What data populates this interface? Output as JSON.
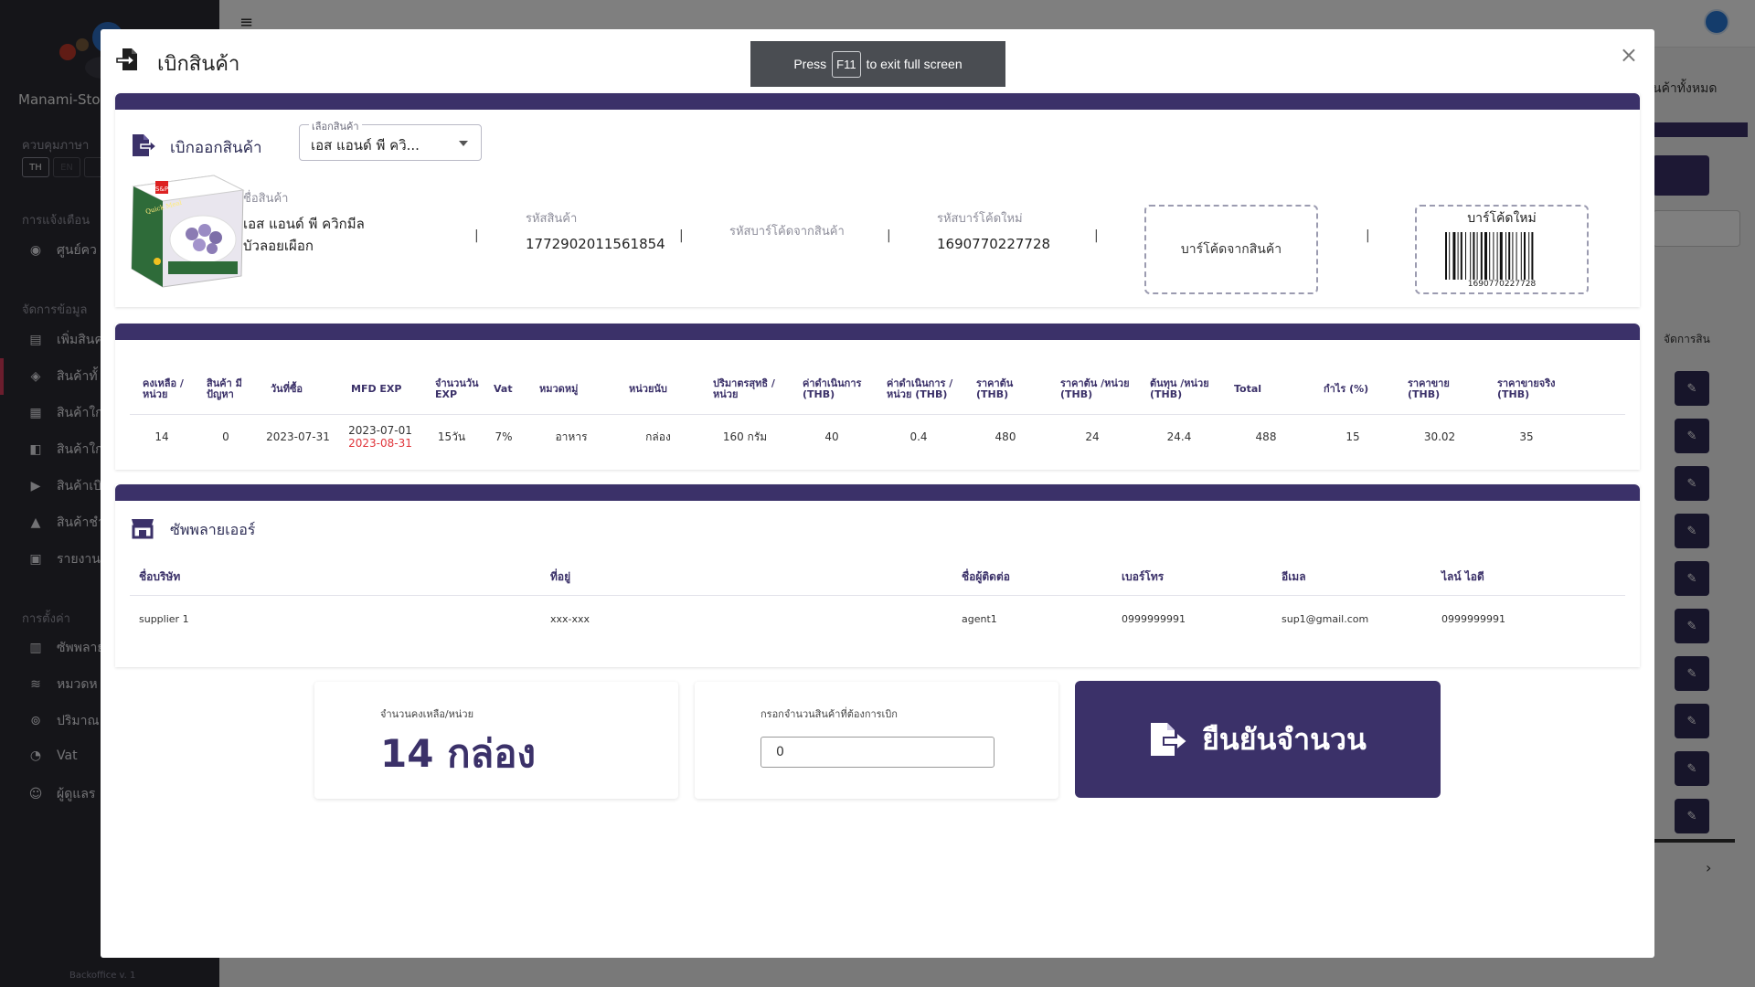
{
  "sidebar": {
    "brand": "Manami-Stoc",
    "sections": {
      "language": "ควบคุมภาษา",
      "notifications": "การแจ้งเตือน",
      "data_management": "จัดการข้อมูล",
      "settings": "การตั้งค่า"
    },
    "languages": [
      "TH",
      "EN",
      ""
    ],
    "items": [
      {
        "label": "ศูนย์คว",
        "icon": "gamepad-icon"
      },
      {
        "label": "เพิ่มสินค",
        "icon": "file-import-icon"
      },
      {
        "label": "สินค้าทั้",
        "icon": "boxes-icon"
      },
      {
        "label": "สินค้าใก",
        "icon": "calendar-icon"
      },
      {
        "label": "สินค้าใก",
        "icon": "layers-icon"
      },
      {
        "label": "สินค้าเบิ",
        "icon": "file-export-icon"
      },
      {
        "label": "สินค้าชำ",
        "icon": "warning-icon"
      },
      {
        "label": "รายงาน",
        "icon": "report-icon"
      },
      {
        "label": "ซัพพลาย",
        "icon": "store-icon"
      },
      {
        "label": "หมวดห",
        "icon": "stack-icon"
      },
      {
        "label": "ปริมาณ",
        "icon": "scale-icon"
      },
      {
        "label": "Vat",
        "icon": "pie-icon"
      },
      {
        "label": "ผู้ดูแลร",
        "icon": "user-gear-icon"
      }
    ],
    "version": "Backoffice v. 1"
  },
  "background": {
    "right_text": "นค้าทั้งหมด",
    "column_label": "จัดการสิน"
  },
  "fullscreen_toast": {
    "press": "Press",
    "key": "F11",
    "rest": "to exit full screen"
  },
  "modal": {
    "title": "เบิกสินค้า",
    "close": "×",
    "product_section": {
      "title": "เบิกออกสินค้า",
      "select_legend": "เลือกสินค้า",
      "select_value": "เอส แอนด์ พี ควิ..."
    },
    "product": {
      "name_label": "ชื่อสินค้า",
      "name_value": "เอส แอนด์ พี ควิกมีล บัวลอยเผือก",
      "code_label": "รหัสสินค้า",
      "code_value": "1772902011561854",
      "barcode_label": "รหัสบาร์โค้ดจากสินค้า",
      "barcode_value": "",
      "new_barcode_label": "รหัสบาร์โค้ดใหม่",
      "new_barcode_value": "1690770227728",
      "barcode_from_product_box": "บาร์โค้ดจากสินค้า",
      "new_barcode_box_title": "บาร์โค้ดใหม่",
      "new_barcode_box_number": "1690770227728",
      "separator": "|",
      "image_brand_text": "Quick Meal"
    },
    "detail_table": {
      "headers": [
        "คงเหลือ /หน่วย",
        "สินค้า มีปัญหา",
        "วันที่ซื้อ",
        "MFD EXP",
        "จำนวนวัน EXP",
        "Vat",
        "หมวดหมู่",
        "หน่วยนับ",
        "ปริมาตรสุทธิ /หน่วย",
        "ค่าดำเนินการ (THB)",
        "ค่าดำเนินการ /หน่วย (THB)",
        "ราคาต้น (THB)",
        "ราคาต้น /หน่วย (THB)",
        "ต้นทุน /หน่วย (THB)",
        "Total",
        "กำไร (%)",
        "ราคาขาย (THB)",
        "ราคาขายจริง (THB)"
      ],
      "row": {
        "remaining": "14",
        "problem": "0",
        "purchase_date": "2023-07-31",
        "mfd": "2023-07-01",
        "exp": "2023-08-31",
        "days_exp": "15วัน",
        "vat": "7%",
        "category": "อาหาร",
        "unit": "กล่อง",
        "net_volume": "160 กรัม",
        "operation_cost": "40",
        "operation_cost_unit": "0.4",
        "base_price": "480",
        "base_price_unit": "24",
        "cost_unit": "24.4",
        "total": "488",
        "profit": "15",
        "sale_price": "30.02",
        "real_sale_price": "35"
      }
    },
    "supplier": {
      "title": "ซัพพลายเออร์",
      "headers": [
        "ชื่อบริษัท",
        "ที่อยู่",
        "ชื่อผู้ติดต่อ",
        "เบอร์โทร",
        "อีเมล",
        "ไลน์ ไอดี"
      ],
      "row": [
        "supplier 1",
        "xxx-xxx",
        "agent1",
        "0999999991",
        "sup1@gmail.com",
        "0999999991"
      ]
    },
    "remaining_card": {
      "label": "จำนวนคงเหลือ/หน่วย",
      "value": "14 กล่อง"
    },
    "input_card": {
      "label": "กรอกจำนวนสินค้าที่ต้องการเบิก",
      "value": "0"
    },
    "confirm_button": "ยืนยันจำนวน"
  },
  "colors": {
    "primary": "#3b3169",
    "danger": "#e0343a",
    "sidebar_bg": "#2b2b33"
  }
}
